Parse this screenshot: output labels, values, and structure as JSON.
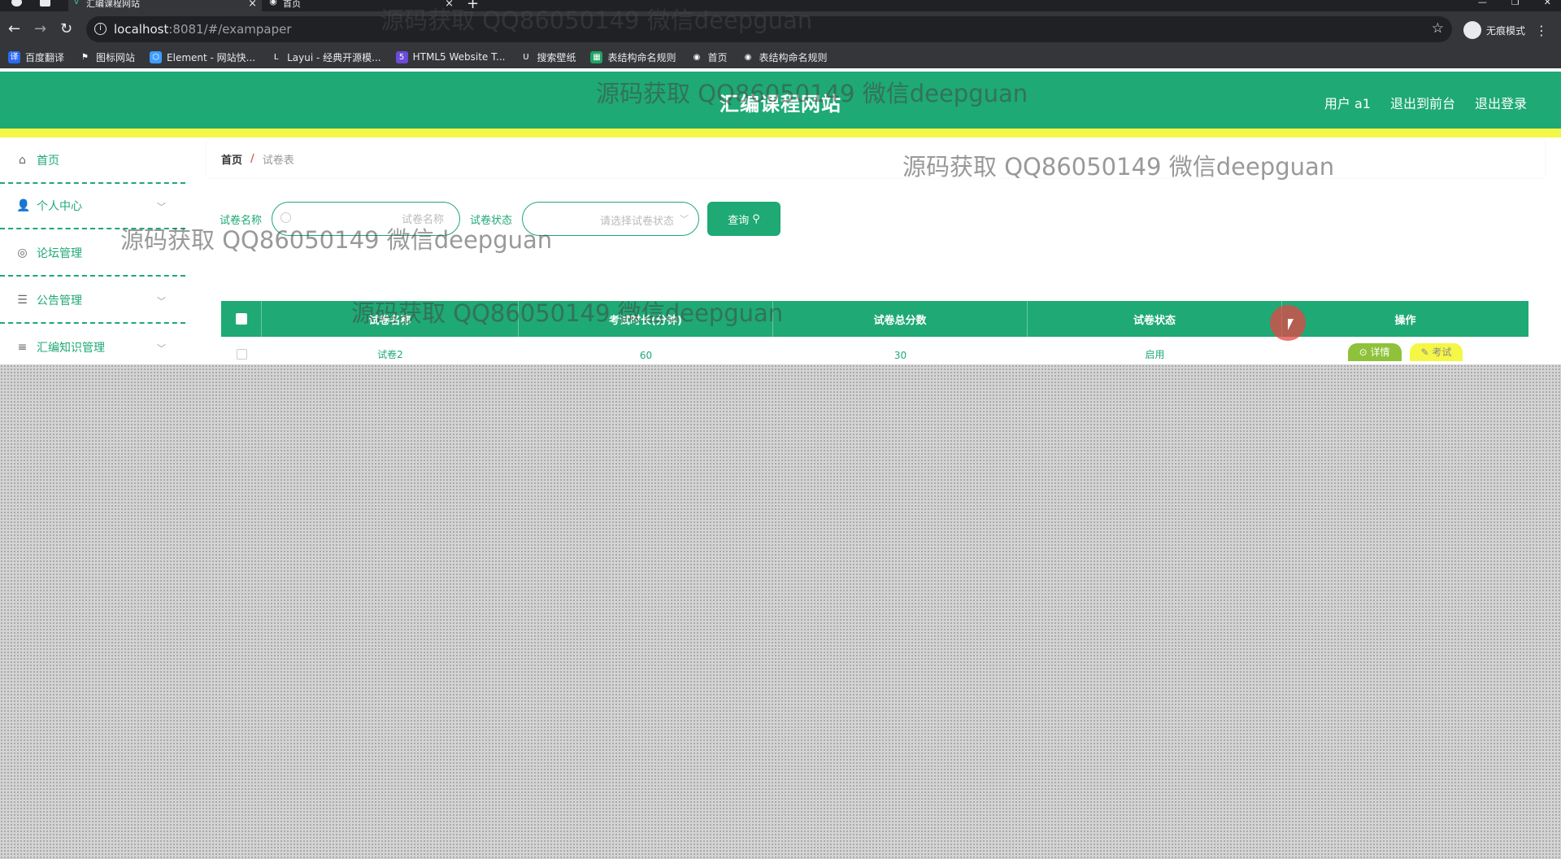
{
  "browser": {
    "tabs": [
      {
        "title": "汇编课程网站",
        "favicon": "vue-icon",
        "active": true
      },
      {
        "title": "首页",
        "favicon": "globe-icon",
        "active": false
      }
    ],
    "url_host": "localhost",
    "url_rest": ":8081/#/exampaper",
    "incognito_label": "无痕模式",
    "bookmarks": [
      {
        "label": "百度翻译",
        "icon": "translate-icon",
        "color": "#2b6bf3"
      },
      {
        "label": "图标网站",
        "icon": "flag-icon",
        "color": "#35363a"
      },
      {
        "label": "Element - 网站快...",
        "icon": "element-icon",
        "color": "#409eff"
      },
      {
        "label": "Layui - 经典开源模...",
        "icon": "layui-icon",
        "color": "#35363a"
      },
      {
        "label": "HTML5 Website T...",
        "icon": "html5-icon",
        "color": "#6b4bd8"
      },
      {
        "label": "搜索壁纸",
        "icon": "wallpaper-icon",
        "color": "#35363a"
      },
      {
        "label": "表结构命名规则",
        "icon": "sheet-icon",
        "color": "#1fa463"
      },
      {
        "label": "首页",
        "icon": "globe-icon",
        "color": "#35363a"
      },
      {
        "label": "表结构命名规则",
        "icon": "globe-icon",
        "color": "#35363a"
      }
    ]
  },
  "watermark": "源码获取 QQ86050149 微信deepguan",
  "header": {
    "title": "汇编课程网站",
    "user": "用户 a1",
    "front_link": "退出到前台",
    "logout": "退出登录"
  },
  "sidebar": {
    "items": [
      {
        "label": "首页",
        "icon": "home-icon",
        "expandable": false
      },
      {
        "label": "个人中心",
        "icon": "user-icon",
        "expandable": true
      },
      {
        "label": "论坛管理",
        "icon": "forum-icon",
        "expandable": false
      },
      {
        "label": "公告管理",
        "icon": "sliders-icon",
        "expandable": true
      },
      {
        "label": "汇编知识管理",
        "icon": "list-icon",
        "expandable": true
      }
    ]
  },
  "breadcrumb": {
    "home": "首页",
    "separator": "/",
    "current": "试卷表"
  },
  "search": {
    "name_label": "试卷名称",
    "name_placeholder": "试卷名称",
    "status_label": "试卷状态",
    "status_placeholder": "请选择试卷状态",
    "button": "查询"
  },
  "table": {
    "columns": [
      "试卷名称",
      "考试时长(分钟)",
      "试卷总分数",
      "试卷状态",
      "操作"
    ],
    "rows": [
      {
        "name": "试卷2",
        "duration": "60",
        "score": "30",
        "status": "启用"
      }
    ],
    "actions": {
      "detail": "详情",
      "exam": "考试"
    }
  },
  "colors": {
    "primary": "#1ea975",
    "accent_yellow": "#f4f746",
    "detail_green": "#8fc23a"
  }
}
